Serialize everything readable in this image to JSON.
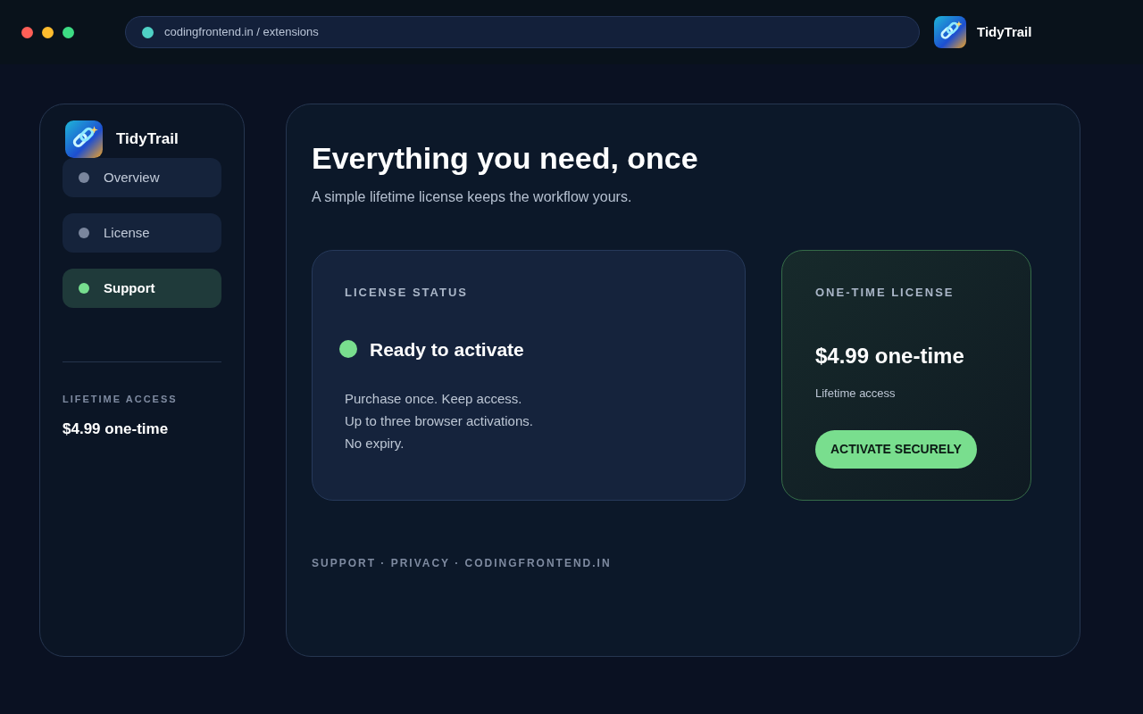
{
  "browser": {
    "address": "codingfrontend.in / extensions",
    "app_name": "TidyTrail"
  },
  "sidebar": {
    "app_name": "TidyTrail",
    "items": [
      {
        "label": "Overview",
        "selected": false
      },
      {
        "label": "License",
        "selected": false
      },
      {
        "label": "Support",
        "selected": true
      }
    ],
    "summary_label": "LIFETIME ACCESS",
    "summary_value": "$4.99 one-time"
  },
  "main": {
    "title": "Everything you need, once",
    "subtitle": "A simple lifetime license keeps the workflow yours.",
    "status_card": {
      "label": "LICENSE STATUS",
      "status": "Ready to activate",
      "lines": [
        "Purchase once. Keep access.",
        "Up to three browser activations.",
        "No expiry."
      ]
    },
    "price_card": {
      "label": "ONE-TIME LICENSE",
      "price": "$4.99 one-time",
      "note": "Lifetime access",
      "button": "ACTIVATE SECURELY"
    },
    "footer": "SUPPORT · PRIVACY · CODINGFRONTEND.IN"
  }
}
